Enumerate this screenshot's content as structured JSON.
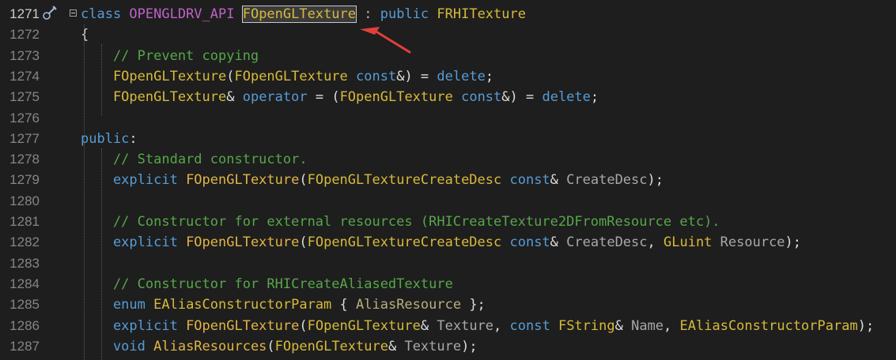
{
  "lines": [
    {
      "num": "1271",
      "active": true,
      "tokens": [
        {
          "t": "class ",
          "c": "kw"
        },
        {
          "t": "OPENGLDRV_API ",
          "c": "mac"
        },
        {
          "t": "FOpenGLTexture",
          "c": "ty",
          "box": true
        },
        {
          "t": " : ",
          "c": "op"
        },
        {
          "t": "public ",
          "c": "kw"
        },
        {
          "t": "FRHITexture",
          "c": "ty"
        }
      ]
    },
    {
      "num": "1272",
      "tokens": [
        {
          "t": "{",
          "c": "pl"
        }
      ]
    },
    {
      "num": "1273",
      "tokens": [
        {
          "t": "    // Prevent copying",
          "c": "cm"
        }
      ]
    },
    {
      "num": "1274",
      "tokens": [
        {
          "t": "    FOpenGLTexture",
          "c": "ty"
        },
        {
          "t": "(",
          "c": "pl"
        },
        {
          "t": "FOpenGLTexture",
          "c": "ty"
        },
        {
          "t": " const",
          "c": "kw"
        },
        {
          "t": "&) = ",
          "c": "pl"
        },
        {
          "t": "delete",
          "c": "kw"
        },
        {
          "t": ";",
          "c": "pl"
        }
      ]
    },
    {
      "num": "1275",
      "tokens": [
        {
          "t": "    FOpenGLTexture",
          "c": "ty"
        },
        {
          "t": "& ",
          "c": "pl"
        },
        {
          "t": "operator",
          "c": "kw"
        },
        {
          "t": " = (",
          "c": "pl"
        },
        {
          "t": "FOpenGLTexture",
          "c": "ty"
        },
        {
          "t": " const",
          "c": "kw"
        },
        {
          "t": "&) = ",
          "c": "pl"
        },
        {
          "t": "delete",
          "c": "kw"
        },
        {
          "t": ";",
          "c": "pl"
        }
      ]
    },
    {
      "num": "1276",
      "tokens": []
    },
    {
      "num": "1277",
      "tokens": [
        {
          "t": "public",
          "c": "kw"
        },
        {
          "t": ":",
          "c": "pl"
        }
      ]
    },
    {
      "num": "1278",
      "tokens": [
        {
          "t": "    // Standard constructor.",
          "c": "cm"
        }
      ]
    },
    {
      "num": "1279",
      "tokens": [
        {
          "t": "    explicit ",
          "c": "kw"
        },
        {
          "t": "FOpenGLTexture",
          "c": "fn"
        },
        {
          "t": "(",
          "c": "pl"
        },
        {
          "t": "FOpenGLTextureCreateDesc",
          "c": "ty"
        },
        {
          "t": " const",
          "c": "kw"
        },
        {
          "t": "& ",
          "c": "pl"
        },
        {
          "t": "CreateDesc",
          "c": "pa"
        },
        {
          "t": ");",
          "c": "pl"
        }
      ]
    },
    {
      "num": "1280",
      "tokens": []
    },
    {
      "num": "1281",
      "tokens": [
        {
          "t": "    // Constructor for external resources (RHICreateTexture2DFromResource etc).",
          "c": "cm"
        }
      ]
    },
    {
      "num": "1282",
      "tokens": [
        {
          "t": "    explicit ",
          "c": "kw"
        },
        {
          "t": "FOpenGLTexture",
          "c": "fn"
        },
        {
          "t": "(",
          "c": "pl"
        },
        {
          "t": "FOpenGLTextureCreateDesc",
          "c": "ty"
        },
        {
          "t": " const",
          "c": "kw"
        },
        {
          "t": "& ",
          "c": "pl"
        },
        {
          "t": "CreateDesc",
          "c": "pa"
        },
        {
          "t": ", ",
          "c": "pl"
        },
        {
          "t": "GLuint",
          "c": "ty"
        },
        {
          "t": " Resource",
          "c": "pa"
        },
        {
          "t": ");",
          "c": "pl"
        }
      ]
    },
    {
      "num": "1283",
      "tokens": []
    },
    {
      "num": "1284",
      "tokens": [
        {
          "t": "    // Constructor for RHICreateAliasedTexture",
          "c": "cm"
        }
      ]
    },
    {
      "num": "1285",
      "tokens": [
        {
          "t": "    enum ",
          "c": "kw"
        },
        {
          "t": "EAliasConstructorParam",
          "c": "ty"
        },
        {
          "t": " { ",
          "c": "pl"
        },
        {
          "t": "AliasResource",
          "c": "enm"
        },
        {
          "t": " };",
          "c": "pl"
        }
      ]
    },
    {
      "num": "1286",
      "tokens": [
        {
          "t": "    explicit ",
          "c": "kw"
        },
        {
          "t": "FOpenGLTexture",
          "c": "fn"
        },
        {
          "t": "(",
          "c": "pl"
        },
        {
          "t": "FOpenGLTexture",
          "c": "ty"
        },
        {
          "t": "& ",
          "c": "pl"
        },
        {
          "t": "Texture",
          "c": "pa"
        },
        {
          "t": ", ",
          "c": "pl"
        },
        {
          "t": "const ",
          "c": "kw"
        },
        {
          "t": "FString",
          "c": "ty"
        },
        {
          "t": "& ",
          "c": "pl"
        },
        {
          "t": "Name",
          "c": "pa"
        },
        {
          "t": ", ",
          "c": "pl"
        },
        {
          "t": "EAliasConstructorParam",
          "c": "ty"
        },
        {
          "t": ");",
          "c": "pl"
        }
      ]
    },
    {
      "num": "1287",
      "tokens": [
        {
          "t": "    void ",
          "c": "kw"
        },
        {
          "t": "AliasResources",
          "c": "fn"
        },
        {
          "t": "(",
          "c": "pl"
        },
        {
          "t": "FOpenGLTexture",
          "c": "ty"
        },
        {
          "t": "& ",
          "c": "pl"
        },
        {
          "t": "Texture",
          "c": "pa"
        },
        {
          "t": ");",
          "c": "pl"
        }
      ]
    }
  ],
  "colors": {
    "background": "#1e1e1e",
    "arrow": "#e0403a"
  },
  "icons": {
    "line_marker": "pin-icon",
    "fold": "fold-collapse-icon",
    "annotation": "red-arrow-icon"
  }
}
